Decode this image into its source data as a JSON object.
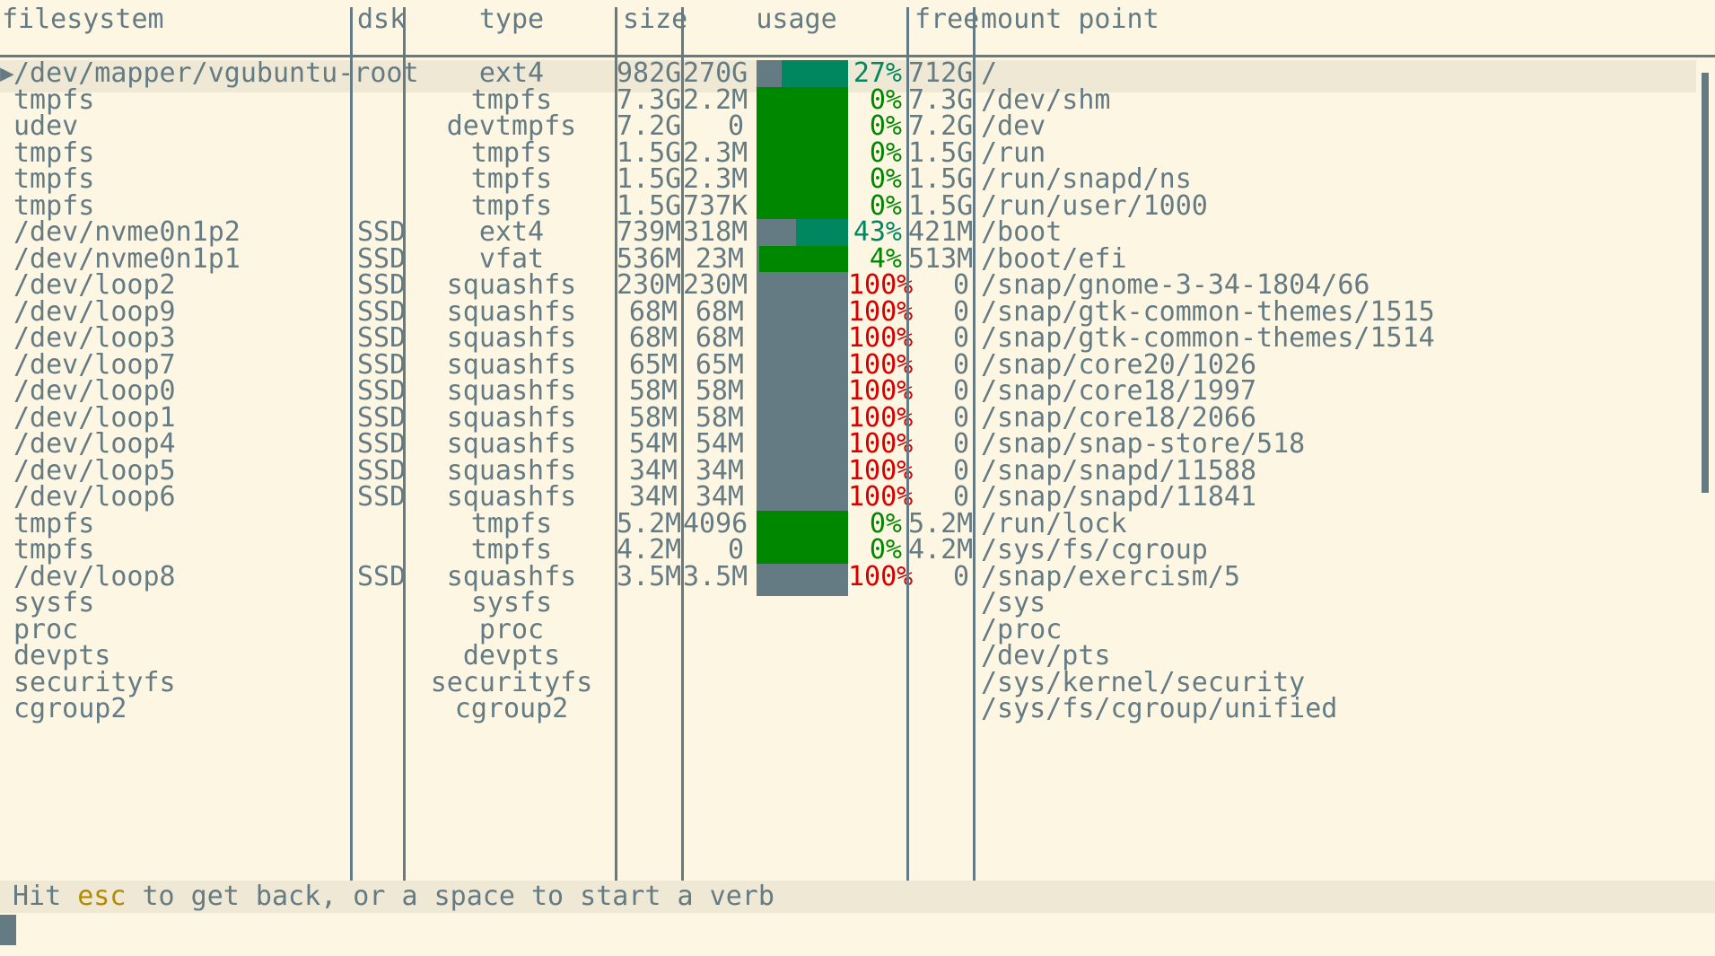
{
  "app": "broot filesystems view",
  "columns": {
    "filesystem": "filesystem",
    "dsk": "dsk",
    "type": "type",
    "size": "size",
    "usage": "usage",
    "free": "free",
    "mount": "mount point"
  },
  "selected_marker": "▶",
  "colors": {
    "background": "#fdf6e3",
    "text": "#657b83",
    "selection": "#eee8d5",
    "free_low": "#008700",
    "free_mid": "#00875f",
    "full": "#d70000",
    "key_highlight": "#b58900"
  },
  "rows": [
    {
      "filesystem": "/dev/mapper/vgubuntu-root",
      "dsk": "",
      "type": "ext4",
      "size": "982G",
      "used": "270G",
      "usage_fraction": 0.27,
      "percent": "27%",
      "free": "712G",
      "mount": "/",
      "selected": true
    },
    {
      "filesystem": "tmpfs",
      "dsk": "",
      "type": "tmpfs",
      "size": "7.3G",
      "used": "2.2M",
      "usage_fraction": 0.0,
      "percent": "0%",
      "free": "7.3G",
      "mount": "/dev/shm"
    },
    {
      "filesystem": "udev",
      "dsk": "",
      "type": "devtmpfs",
      "size": "7.2G",
      "used": "0",
      "usage_fraction": 0.0,
      "percent": "0%",
      "free": "7.2G",
      "mount": "/dev"
    },
    {
      "filesystem": "tmpfs",
      "dsk": "",
      "type": "tmpfs",
      "size": "1.5G",
      "used": "2.3M",
      "usage_fraction": 0.0,
      "percent": "0%",
      "free": "1.5G",
      "mount": "/run"
    },
    {
      "filesystem": "tmpfs",
      "dsk": "",
      "type": "tmpfs",
      "size": "1.5G",
      "used": "2.3M",
      "usage_fraction": 0.0,
      "percent": "0%",
      "free": "1.5G",
      "mount": "/run/snapd/ns"
    },
    {
      "filesystem": "tmpfs",
      "dsk": "",
      "type": "tmpfs",
      "size": "1.5G",
      "used": "737K",
      "usage_fraction": 0.0,
      "percent": "0%",
      "free": "1.5G",
      "mount": "/run/user/1000"
    },
    {
      "filesystem": "/dev/nvme0n1p2",
      "dsk": "SSD",
      "type": "ext4",
      "size": "739M",
      "used": "318M",
      "usage_fraction": 0.43,
      "percent": "43%",
      "free": "421M",
      "mount": "/boot"
    },
    {
      "filesystem": "/dev/nvme0n1p1",
      "dsk": "SSD",
      "type": "vfat",
      "size": "536M",
      "used": "23M",
      "usage_fraction": 0.04,
      "percent": "4%",
      "free": "513M",
      "mount": "/boot/efi"
    },
    {
      "filesystem": "/dev/loop2",
      "dsk": "SSD",
      "type": "squashfs",
      "size": "230M",
      "used": "230M",
      "usage_fraction": 1.0,
      "percent": "100%",
      "free": "0",
      "mount": "/snap/gnome-3-34-1804/66"
    },
    {
      "filesystem": "/dev/loop9",
      "dsk": "SSD",
      "type": "squashfs",
      "size": "68M",
      "used": "68M",
      "usage_fraction": 1.0,
      "percent": "100%",
      "free": "0",
      "mount": "/snap/gtk-common-themes/1515"
    },
    {
      "filesystem": "/dev/loop3",
      "dsk": "SSD",
      "type": "squashfs",
      "size": "68M",
      "used": "68M",
      "usage_fraction": 1.0,
      "percent": "100%",
      "free": "0",
      "mount": "/snap/gtk-common-themes/1514"
    },
    {
      "filesystem": "/dev/loop7",
      "dsk": "SSD",
      "type": "squashfs",
      "size": "65M",
      "used": "65M",
      "usage_fraction": 1.0,
      "percent": "100%",
      "free": "0",
      "mount": "/snap/core20/1026"
    },
    {
      "filesystem": "/dev/loop0",
      "dsk": "SSD",
      "type": "squashfs",
      "size": "58M",
      "used": "58M",
      "usage_fraction": 1.0,
      "percent": "100%",
      "free": "0",
      "mount": "/snap/core18/1997"
    },
    {
      "filesystem": "/dev/loop1",
      "dsk": "SSD",
      "type": "squashfs",
      "size": "58M",
      "used": "58M",
      "usage_fraction": 1.0,
      "percent": "100%",
      "free": "0",
      "mount": "/snap/core18/2066"
    },
    {
      "filesystem": "/dev/loop4",
      "dsk": "SSD",
      "type": "squashfs",
      "size": "54M",
      "used": "54M",
      "usage_fraction": 1.0,
      "percent": "100%",
      "free": "0",
      "mount": "/snap/snap-store/518"
    },
    {
      "filesystem": "/dev/loop5",
      "dsk": "SSD",
      "type": "squashfs",
      "size": "34M",
      "used": "34M",
      "usage_fraction": 1.0,
      "percent": "100%",
      "free": "0",
      "mount": "/snap/snapd/11588"
    },
    {
      "filesystem": "/dev/loop6",
      "dsk": "SSD",
      "type": "squashfs",
      "size": "34M",
      "used": "34M",
      "usage_fraction": 1.0,
      "percent": "100%",
      "free": "0",
      "mount": "/snap/snapd/11841"
    },
    {
      "filesystem": "tmpfs",
      "dsk": "",
      "type": "tmpfs",
      "size": "5.2M",
      "used": "4096",
      "usage_fraction": 0.0,
      "percent": "0%",
      "free": "5.2M",
      "mount": "/run/lock"
    },
    {
      "filesystem": "tmpfs",
      "dsk": "",
      "type": "tmpfs",
      "size": "4.2M",
      "used": "0",
      "usage_fraction": 0.0,
      "percent": "0%",
      "free": "4.2M",
      "mount": "/sys/fs/cgroup"
    },
    {
      "filesystem": "/dev/loop8",
      "dsk": "SSD",
      "type": "squashfs",
      "size": "3.5M",
      "used": "3.5M",
      "usage_fraction": 1.0,
      "percent": "100%",
      "free": "0",
      "mount": "/snap/exercism/5"
    },
    {
      "filesystem": "sysfs",
      "dsk": "",
      "type": "sysfs",
      "size": "",
      "used": "",
      "usage_fraction": null,
      "percent": "",
      "free": "",
      "mount": "/sys"
    },
    {
      "filesystem": "proc",
      "dsk": "",
      "type": "proc",
      "size": "",
      "used": "",
      "usage_fraction": null,
      "percent": "",
      "free": "",
      "mount": "/proc"
    },
    {
      "filesystem": "devpts",
      "dsk": "",
      "type": "devpts",
      "size": "",
      "used": "",
      "usage_fraction": null,
      "percent": "",
      "free": "",
      "mount": "/dev/pts"
    },
    {
      "filesystem": "securityfs",
      "dsk": "",
      "type": "securityfs",
      "size": "",
      "used": "",
      "usage_fraction": null,
      "percent": "",
      "free": "",
      "mount": "/sys/kernel/security"
    },
    {
      "filesystem": "cgroup2",
      "dsk": "",
      "type": "cgroup2",
      "size": "",
      "used": "",
      "usage_fraction": null,
      "percent": "",
      "free": "",
      "mount": "/sys/fs/cgroup/unified"
    }
  ],
  "status": {
    "prefix": "Hit ",
    "key": "esc",
    "suffix": " to get back, or a space to start a verb"
  }
}
